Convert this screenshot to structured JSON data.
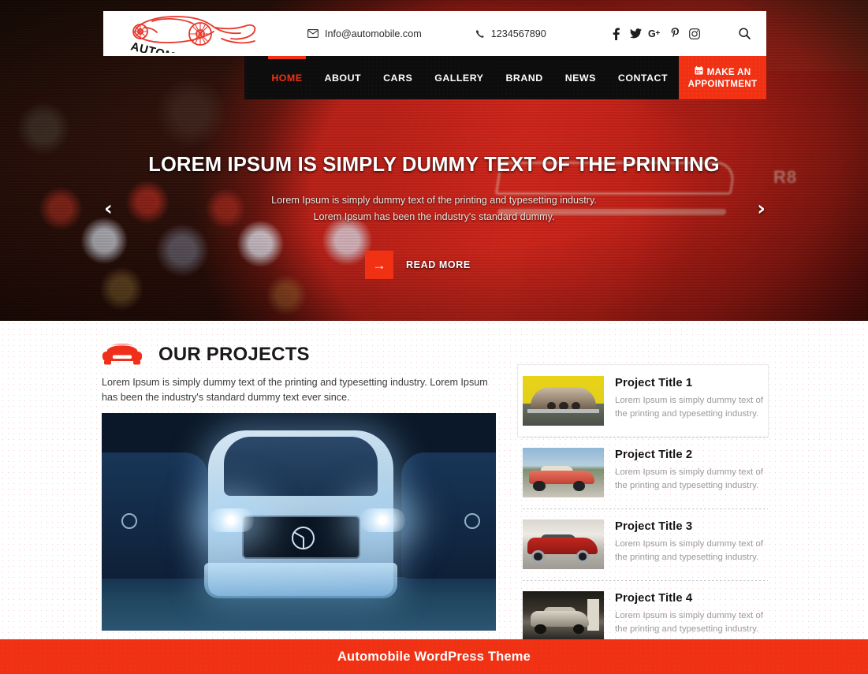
{
  "theme": {
    "accent_color": "#F03113",
    "nav_bg_color": "#0D0D0D",
    "text_dark": "#141414"
  },
  "header": {
    "logo": {
      "brand_text": "AUTOMOBILE",
      "icon": "car-logo-icon"
    },
    "email": {
      "icon": "envelope-icon",
      "value": "Info@automobile.com"
    },
    "phone": {
      "icon": "phone-icon",
      "value": "1234567890"
    },
    "socials": [
      {
        "name": "facebook-icon",
        "glyph": "f"
      },
      {
        "name": "twitter-icon",
        "glyph": "t"
      },
      {
        "name": "google-plus-icon",
        "glyph": "G+"
      },
      {
        "name": "pinterest-icon",
        "glyph": "P"
      },
      {
        "name": "instagram-icon",
        "glyph": "ig"
      }
    ],
    "search": {
      "icon": "search-icon",
      "label": "Search"
    },
    "nav": [
      {
        "label": "HOME",
        "active": true
      },
      {
        "label": "ABOUT",
        "active": false
      },
      {
        "label": "CARS",
        "active": false
      },
      {
        "label": "GALLERY",
        "active": false
      },
      {
        "label": "BRAND",
        "active": false
      },
      {
        "label": "NEWS",
        "active": false
      },
      {
        "label": "CONTACT",
        "active": false
      }
    ],
    "appointment": {
      "icon": "calendar-icon",
      "line1": "MAKE AN",
      "line2": "APPOINTMENT"
    }
  },
  "hero": {
    "title": "LOREM IPSUM IS SIMPLY DUMMY TEXT OF THE PRINTING",
    "subtitle": "Lorem Ipsum is simply dummy text of the printing and typesetting industry. Lorem Ipsum has been the industry's standard dummy.",
    "cta_label": "READ MORE",
    "cta_icon": "arrow-right-icon",
    "prev_icon": "chevron-left-icon",
    "next_icon": "chevron-right-icon",
    "prev_glyph": "‹",
    "next_glyph": "›",
    "cta_arrow_glyph": "→"
  },
  "projects": {
    "heading_icon": "car-front-icon",
    "heading": "OUR PROJECTS",
    "description": "Lorem Ipsum is simply dummy text of the printing and typesetting industry. Lorem Ipsum has been the industry's standard dummy text ever since.",
    "featured_image_alt": "mercedes-front-headlights-photo",
    "items": [
      {
        "title": "Project Title 1",
        "description": "Lorem Ipsum is simply dummy text of the printing and typesetting industry.",
        "thumb": "vintage-jaguar-yellow-wall-photo",
        "active": true
      },
      {
        "title": "Project Title 2",
        "description": "Lorem Ipsum is simply dummy text of the printing and typesetting industry.",
        "thumb": "red-convertible-roadside-photo",
        "active": false
      },
      {
        "title": "Project Title 3",
        "description": "Lorem Ipsum is simply dummy text of the printing and typesetting industry.",
        "thumb": "red-sports-coupe-garage-photo",
        "active": false
      },
      {
        "title": "Project Title 4",
        "description": "Lorem Ipsum is simply dummy text of the printing and typesetting industry.",
        "thumb": "classic-pickup-truck-station-photo",
        "active": false
      }
    ]
  },
  "footer": {
    "text": "Automobile WordPress Theme"
  }
}
